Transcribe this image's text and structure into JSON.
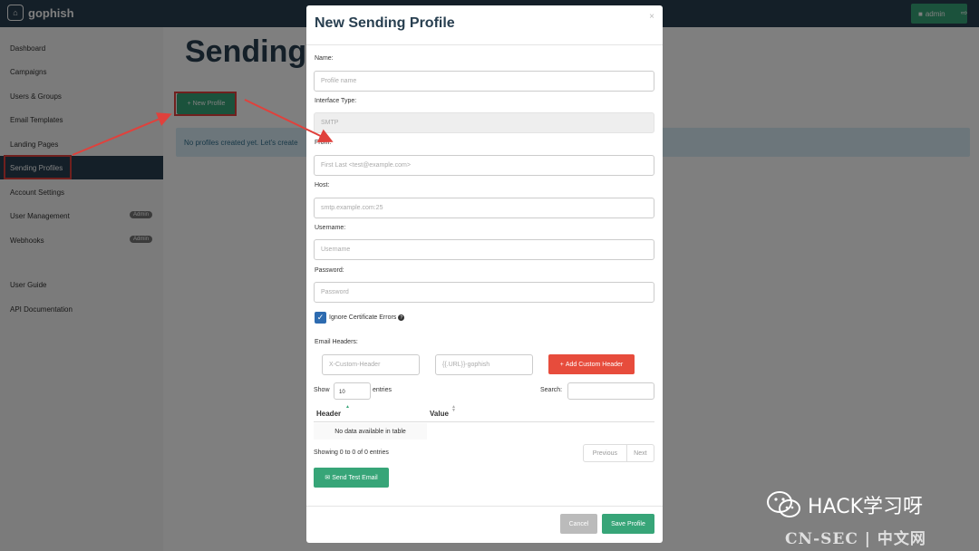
{
  "navbar": {
    "brand": "gophish",
    "brand_icon": "gophish-logo-icon",
    "admin_label": "admin",
    "colors": {
      "navbar_bg": "#283f50",
      "accent": "#37a578"
    }
  },
  "sidebar": {
    "items": [
      {
        "label": "Dashboard",
        "badge": ""
      },
      {
        "label": "Campaigns",
        "badge": ""
      },
      {
        "label": "Users & Groups",
        "badge": ""
      },
      {
        "label": "Email Templates",
        "badge": ""
      },
      {
        "label": "Landing Pages",
        "badge": ""
      },
      {
        "label": "Sending Profiles",
        "badge": "",
        "active": true
      },
      {
        "label": "Account Settings",
        "badge": ""
      },
      {
        "label": "User Management",
        "badge": "Admin"
      },
      {
        "label": "Webhooks",
        "badge": "Admin"
      }
    ],
    "bottom_items": [
      {
        "label": "User Guide"
      },
      {
        "label": "API Documentation"
      }
    ]
  },
  "page": {
    "title": "Sending",
    "new_profile_label": "New Profile",
    "alert_text": "No profiles created yet. Let's create"
  },
  "modal": {
    "title": "New Sending Profile",
    "close": "×",
    "fields": {
      "name": {
        "label": "Name:",
        "placeholder": "Profile name"
      },
      "interface_type": {
        "label": "Interface Type:",
        "value": "SMTP"
      },
      "from": {
        "label": "From:",
        "placeholder": "First Last <test@example.com>"
      },
      "host": {
        "label": "Host:",
        "placeholder": "smtp.example.com:25"
      },
      "username": {
        "label": "Username:",
        "placeholder": "Username"
      },
      "password": {
        "label": "Password:",
        "placeholder": "Password"
      }
    },
    "ignore_cert": {
      "label": "Ignore Certificate Errors",
      "checked": true
    },
    "email_headers": {
      "label": "Email Headers:",
      "header_placeholder": "X-Custom-Header",
      "value_placeholder": "{{.URL}}-gophish",
      "add_label": "Add Custom Header"
    },
    "table": {
      "show_label": "Show",
      "show_value": "10",
      "entries_label": "entries",
      "search_label": "Search:",
      "columns": [
        "Header",
        "Value"
      ],
      "empty_text": "No data available in table",
      "info": "Showing 0 to 0 of 0 entries",
      "prev": "Previous",
      "next": "Next"
    },
    "send_test_label": "Send Test Email",
    "cancel_label": "Cancel",
    "save_label": "Save Profile"
  },
  "watermark": {
    "text": "HACK学习呀",
    "sub": "CN-SEC | 中文网"
  }
}
